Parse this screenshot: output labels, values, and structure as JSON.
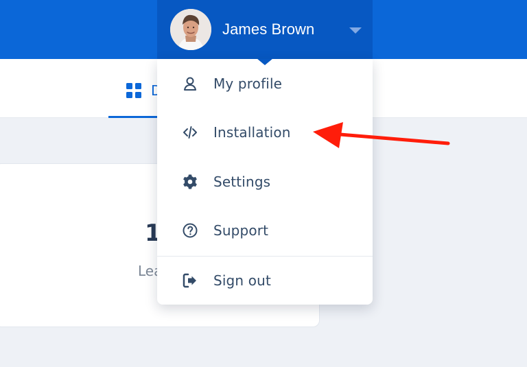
{
  "user": {
    "name": "James Brown"
  },
  "tabs": [
    {
      "label": "D",
      "icon": "grid-icon"
    }
  ],
  "background_card": {
    "text": "Lea",
    "digit": "1"
  },
  "dropdown": {
    "items": [
      {
        "label": "My profile",
        "icon": "user-icon"
      },
      {
        "label": "Installation",
        "icon": "code-icon"
      },
      {
        "label": "Settings",
        "icon": "gear-icon"
      },
      {
        "label": "Support",
        "icon": "help-circle-icon"
      },
      {
        "label": "Sign out",
        "icon": "sign-out-icon"
      }
    ]
  },
  "colors": {
    "header_blue": "#0b67d8",
    "user_button_blue": "#0758c2",
    "menu_text": "#334b68",
    "annotation_red": "#ff1d0a",
    "page_background": "#eef1f6"
  }
}
